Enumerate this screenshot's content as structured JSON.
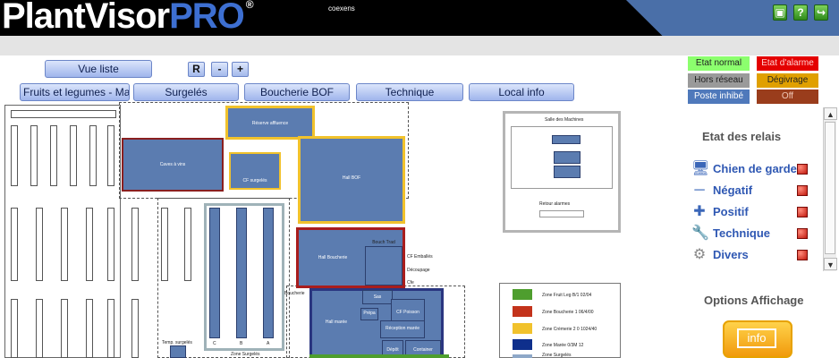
{
  "header": {
    "logo_main": "PlantVisor",
    "logo_pro": "PRO",
    "logo_reg": "®",
    "brand_sub": "coexens",
    "icons": [
      "lock-icon",
      "help-icon",
      "exit-icon"
    ]
  },
  "toolbar": {
    "view_list": "Vue liste",
    "zoom_reset": "R",
    "zoom_out": "-",
    "zoom_in": "+"
  },
  "tabs": [
    {
      "label": "Fruits et legumes - Ma"
    },
    {
      "label": "Surgelés"
    },
    {
      "label": "Boucherie BOF"
    },
    {
      "label": "Technique"
    },
    {
      "label": "Local info"
    }
  ],
  "legend": {
    "etat_normal": "Etat normal",
    "etat_alarme": "Etat d'alarme",
    "hors_reseau": "Hors réseau",
    "degivrage": "Dégivrage",
    "poste_inhibe": "Poste inhibé",
    "off": "Off",
    "colors": {
      "normal": "#8cff6e",
      "alarme": "#e40000",
      "hors": "#9a9a9a",
      "degivrage": "#e0a000",
      "inhibe": "#4f79bb",
      "off": "#9a3d1c"
    }
  },
  "map": {
    "zones": {
      "reserve": "Réserve affluence",
      "chaud_cuisson": "Caves à vins",
      "cf_surgeles": "CF surgelés",
      "hall_bof": "Hall BOF",
      "hall_boucherie": "Hall Boucherie",
      "boucherie_trad": "Bouch Trad",
      "cf_emu": "CF Emballés",
      "decoupage": "Découpage",
      "cfe": "Cfe",
      "sas": "Sas",
      "cf_poisson": "CF Poisson",
      "prepa": "Prépa",
      "hall_maree": "Hall marée",
      "reception_maree": "Réception marée",
      "depot": "Dépôt",
      "container": "Container",
      "boucherie_label": "Boucherie",
      "temp_surgeles": "Temp. surgelés",
      "zone_surgeles": "Zone Surgelés",
      "rack_c": "C",
      "rack_b": "B",
      "rack_a": "A",
      "local_machines": "Salle des Machines",
      "retour_alarmes": "Retour alarmes"
    },
    "map_legend": [
      {
        "label": "Zone Fruit Leg B/1 02/04",
        "color": "#4e9e2e"
      },
      {
        "label": "Zone Boucherie 1 06/4/00",
        "color": "#c3331b"
      },
      {
        "label": "Zone Crèmerie 2 0 1024/40",
        "color": "#f1c22c"
      },
      {
        "label": "Zone Marée 0/3M 12",
        "color": "#0e2f8c"
      },
      {
        "label": "Zone Surgelés",
        "color": "#8ea8c8"
      }
    ]
  },
  "relais": {
    "title": "Etat des relais",
    "items": [
      {
        "label": "Chien de garde",
        "icon": "computer-icon"
      },
      {
        "label": "Négatif",
        "icon": "minus-icon"
      },
      {
        "label": "Positif",
        "icon": "plus-icon"
      },
      {
        "label": "Technique",
        "icon": "tools-icon"
      },
      {
        "label": "Divers",
        "icon": "gear-icon"
      }
    ]
  },
  "options": {
    "title": "Options Affichage",
    "info_label": "info"
  }
}
